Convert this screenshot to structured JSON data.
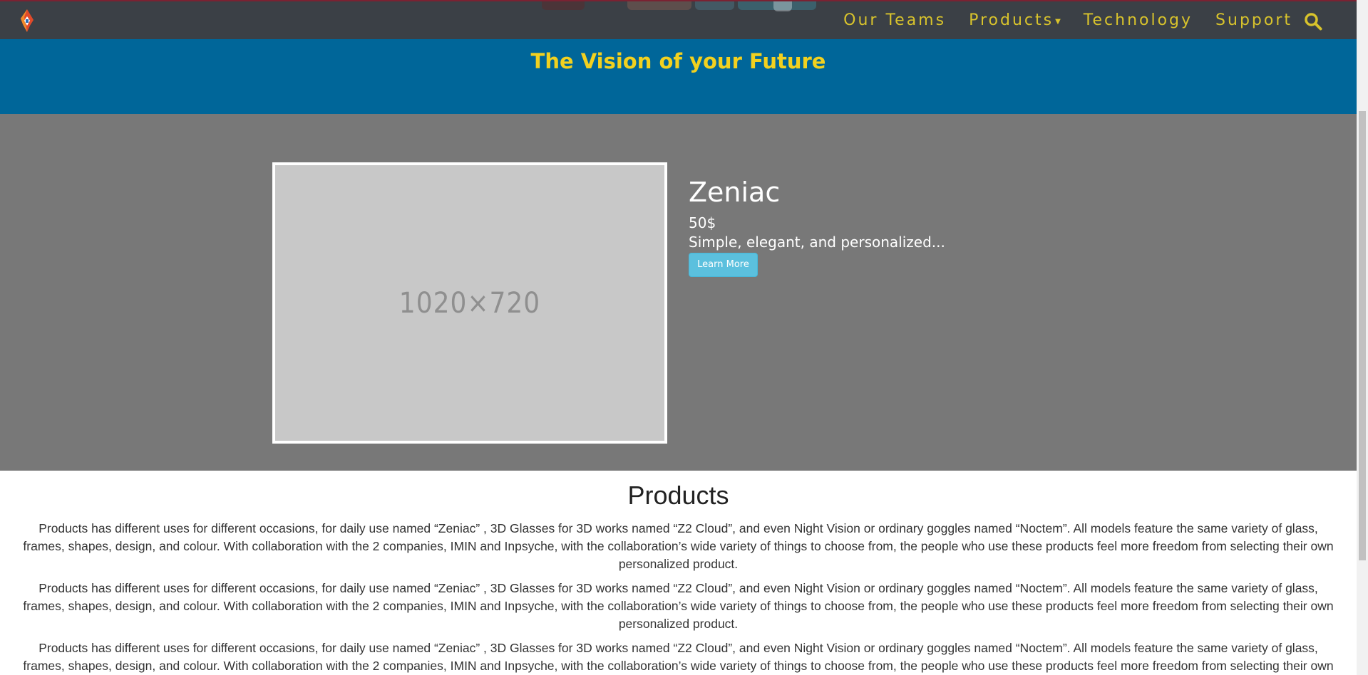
{
  "navbar": {
    "brand_icon": "brand-logo-icon",
    "items": [
      {
        "label": "Our Teams"
      },
      {
        "label": "Products",
        "has_dropdown": true
      },
      {
        "label": "Technology"
      },
      {
        "label": "Support"
      }
    ],
    "search_icon": "search-icon",
    "text_color": "#d8c32c",
    "background": "#3b4046"
  },
  "hero": {
    "title": "The Vision of your Future",
    "background": "#006699",
    "title_color": "#f2d11f"
  },
  "feature": {
    "image_placeholder": "1020×720",
    "name": "Zeniac",
    "price": "50$",
    "tagline": "Simple, elegant, and personalized...",
    "button_label": "Learn More",
    "background": "#787878",
    "button_color": "#5bc0de"
  },
  "products": {
    "heading": "Products",
    "paragraphs": [
      "Products has different uses for different occasions, for daily use named “Zeniac” , 3D Glasses for 3D works named “Z2 Cloud”, and even Night Vision or ordinary goggles named “Noctem”. All models feature the same variety of glass, frames, shapes, design, and colour. With collaboration with the 2 companies, IMIN and Inpsyche, with the collaboration’s wide variety of things to choose from, the people who use these products feel more freedom from selecting their own personalized product.",
      "Products has different uses for different occasions, for daily use named “Zeniac” , 3D Glasses for 3D works named “Z2 Cloud”, and even Night Vision or ordinary goggles named “Noctem”. All models feature the same variety of glass, frames, shapes, design, and colour. With collaboration with the 2 companies, IMIN and Inpsyche, with the collaboration’s wide variety of things to choose from, the people who use these products feel more freedom from selecting their own personalized product.",
      "Products has different uses for different occasions, for daily use named “Zeniac” , 3D Glasses for 3D works named “Z2 Cloud”, and even Night Vision or ordinary goggles named “Noctem”. All models feature the same variety of glass, frames, shapes, design, and colour. With collaboration with the 2 companies, IMIN and Inpsyche, with the collaboration’s wide variety of things to choose from, the people who use these products feel more freedom from selecting their own personalized product."
    ]
  }
}
